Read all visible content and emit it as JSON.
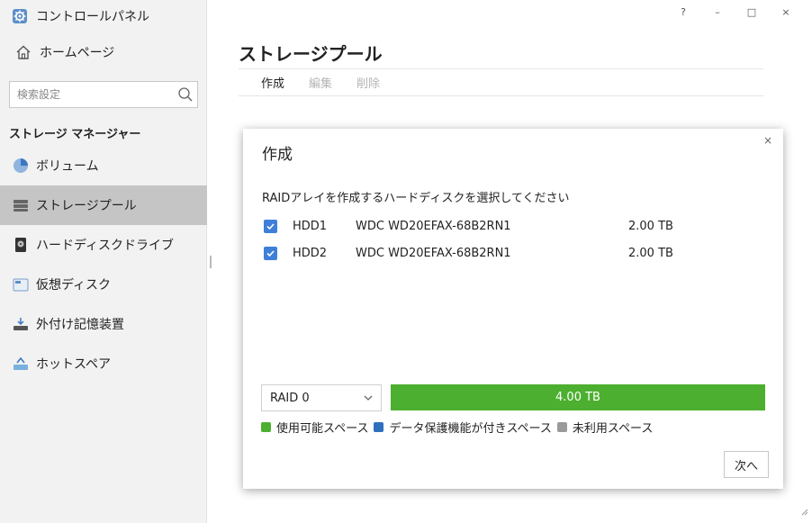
{
  "sidebar": {
    "app_title": "コントロールパネル",
    "home_label": "ホームページ",
    "search_placeholder": "検索設定",
    "section_title": "ストレージ マネージャー",
    "items": [
      {
        "label": "ボリューム",
        "icon": "volume-pie-icon"
      },
      {
        "label": "ストレージプール",
        "icon": "storage-pool-icon"
      },
      {
        "label": "ハードディスクドライブ",
        "icon": "hard-disk-icon"
      },
      {
        "label": "仮想ディスク",
        "icon": "virtual-disk-icon"
      },
      {
        "label": "外付け記憶装置",
        "icon": "external-storage-icon"
      },
      {
        "label": "ホットスペア",
        "icon": "hot-spare-icon"
      }
    ],
    "active_index": 1
  },
  "window": {
    "help_label": "?",
    "minimize_label": "–",
    "maximize_label": "□",
    "close_label": "×"
  },
  "main": {
    "title": "ストレージプール",
    "toolbar": {
      "create": "作成",
      "edit": "編集",
      "delete": "削除"
    }
  },
  "dialog": {
    "close_label": "×",
    "title": "作成",
    "prompt": "RAIDアレイを作成するハードディスクを選択してください",
    "disks": [
      {
        "id": "HDD1",
        "model": "WDC WD20EFAX-68B2RN1",
        "size": "2.00 TB",
        "checked": true
      },
      {
        "id": "HDD2",
        "model": "WDC WD20EFAX-68B2RN1",
        "size": "2.00 TB",
        "checked": true
      }
    ],
    "raid_level": "RAID 0",
    "capacity_label": "4.00 TB",
    "capacity_used_fraction": 1.0,
    "legend": {
      "usable": "使用可能スペース",
      "protection": "データ保護機能が付きスペース",
      "unused": "未利用スペース"
    },
    "next_label": "次へ"
  },
  "colors": {
    "usable": "#4caf2f",
    "protection": "#2f6fbd",
    "unused": "#9a9a9a",
    "checkbox": "#3d7fd9",
    "active_nav": "#c5c5c5"
  }
}
